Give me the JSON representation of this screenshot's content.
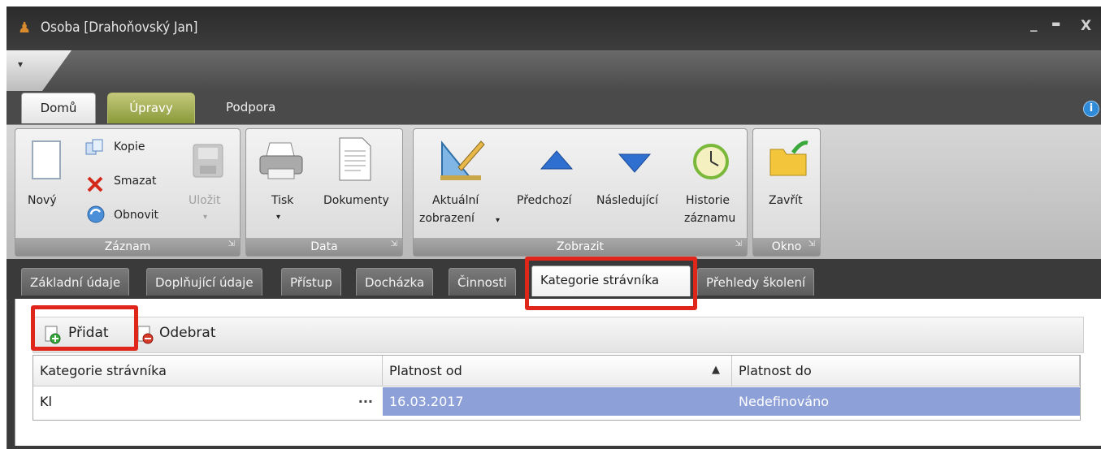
{
  "window": {
    "title": "Osoba [Drahoňovský Jan]",
    "minimize": "_",
    "maximize": "▬",
    "close": "X"
  },
  "qat": {
    "arrow": "▾"
  },
  "ribbon_tabs": [
    "Domů",
    "Úpravy",
    "Podpora"
  ],
  "info": "i",
  "groups": {
    "zaznam": {
      "label": "Záznam",
      "new": "Nový",
      "copy": "Kopie",
      "delete": "Smazat",
      "refresh": "Obnovit",
      "save": "Uložit"
    },
    "data": {
      "label": "Data",
      "print": "Tisk",
      "documents": "Dokumenty"
    },
    "zobrazit": {
      "label": "Zobrazit",
      "current_view_1": "Aktuální",
      "current_view_2": "zobrazení",
      "previous": "Předchozí",
      "next": "Následující",
      "history_1": "Historie",
      "history_2": "záznamu"
    },
    "okno": {
      "label": "Okno",
      "close": "Zavřít"
    }
  },
  "page_tabs": [
    "Základní údaje",
    "Doplňující údaje",
    "Přístup",
    "Docházka",
    "Činnosti",
    "Kategorie strávníka",
    "Přehledy školení"
  ],
  "toolbar": {
    "add": "Přidat",
    "remove": "Odebrat"
  },
  "grid": {
    "columns": [
      "Kategorie strávníka",
      "Platnost od",
      "Platnost do"
    ],
    "sort_indicator": "▲",
    "rows": [
      {
        "category": "Kl",
        "ellipsis": "···",
        "from": "16.03.2017",
        "to": "Nedefinováno"
      }
    ]
  },
  "colors": {
    "highlight": "#e0251b",
    "selected_row": "#8ea0d8"
  }
}
